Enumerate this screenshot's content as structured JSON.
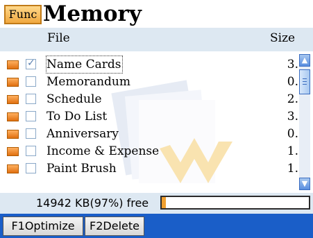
{
  "titlebar": {
    "func_label": "Func",
    "title": "Memory"
  },
  "header": {
    "file_label": "File",
    "size_label": "Size"
  },
  "files": [
    {
      "name": "Name Cards",
      "size": "3.",
      "checked": true,
      "selected": true
    },
    {
      "name": "Memorandum",
      "size": "0.",
      "checked": false,
      "selected": false
    },
    {
      "name": "Schedule",
      "size": "2.",
      "checked": false,
      "selected": false
    },
    {
      "name": "To Do List",
      "size": "3.",
      "checked": false,
      "selected": false
    },
    {
      "name": "Anniversary",
      "size": "0.",
      "checked": false,
      "selected": false
    },
    {
      "name": "Income & Expense",
      "size": "1.",
      "checked": false,
      "selected": false
    },
    {
      "name": "Paint Brush",
      "size": "1.",
      "checked": false,
      "selected": false
    }
  ],
  "status": {
    "free_text": "14942 KB(97%) free",
    "used_fraction": 0.03
  },
  "buttons": {
    "optimize": "F1Optimize",
    "delete": "F2Delete"
  },
  "icons": {
    "scroll_up": "▲",
    "scroll_down": "▼"
  },
  "colors": {
    "accent": "#f0a030",
    "bar_blue": "#1a5ec8",
    "header_bg": "#dde8f2"
  }
}
